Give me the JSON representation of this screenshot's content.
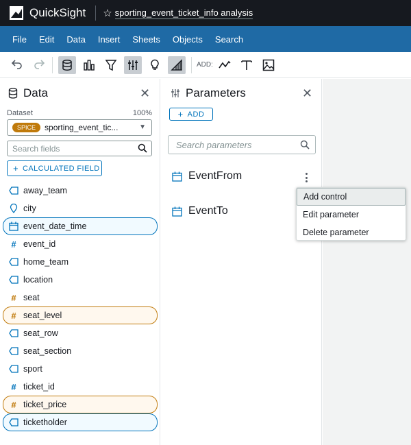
{
  "app": {
    "brand": "QuickSight",
    "analysis_title": "sporting_event_ticket_info analysis"
  },
  "menu": [
    "File",
    "Edit",
    "Data",
    "Insert",
    "Sheets",
    "Objects",
    "Search"
  ],
  "toolbar": {
    "add_label": "ADD:",
    "icons": [
      "undo-icon",
      "redo-icon",
      "data-icon",
      "visualize-icon",
      "filter-icon",
      "parameters-icon",
      "insights-icon",
      "ml-insights-icon",
      "add-line-chart-icon",
      "add-text-icon",
      "add-image-icon"
    ]
  },
  "data_panel": {
    "title": "Data",
    "dataset_label": "Dataset",
    "dataset_percent": "100%",
    "spice_badge": "SPICE",
    "dataset_name": "sporting_event_tic...",
    "search_placeholder": "Search fields",
    "calculated_field_label": "CALCULATED FIELD",
    "fields": [
      {
        "name": "away_team",
        "type": "string",
        "selected": ""
      },
      {
        "name": "city",
        "type": "geo",
        "selected": ""
      },
      {
        "name": "event_date_time",
        "type": "date",
        "selected": "blue"
      },
      {
        "name": "event_id",
        "type": "number-blue",
        "selected": ""
      },
      {
        "name": "home_team",
        "type": "string",
        "selected": ""
      },
      {
        "name": "location",
        "type": "string",
        "selected": ""
      },
      {
        "name": "seat",
        "type": "number-orange",
        "selected": ""
      },
      {
        "name": "seat_level",
        "type": "number-orange",
        "selected": "orange"
      },
      {
        "name": "seat_row",
        "type": "string",
        "selected": ""
      },
      {
        "name": "seat_section",
        "type": "string",
        "selected": ""
      },
      {
        "name": "sport",
        "type": "string",
        "selected": ""
      },
      {
        "name": "ticket_id",
        "type": "number-blue",
        "selected": ""
      },
      {
        "name": "ticket_price",
        "type": "number-orange",
        "selected": "orange"
      },
      {
        "name": "ticketholder",
        "type": "string",
        "selected": "blue"
      }
    ]
  },
  "parameters_panel": {
    "title": "Parameters",
    "add_label": "ADD",
    "search_placeholder": "Search parameters",
    "parameters": [
      "EventFrom",
      "EventTo"
    ]
  },
  "context_menu": {
    "items": [
      "Add control",
      "Edit parameter",
      "Delete parameter"
    ],
    "hovered": "Add control"
  },
  "colors": {
    "menubar": "#1f6aa5",
    "titlebar": "#16191f",
    "accent_blue": "#0073bb",
    "accent_orange": "#c07a0b"
  }
}
